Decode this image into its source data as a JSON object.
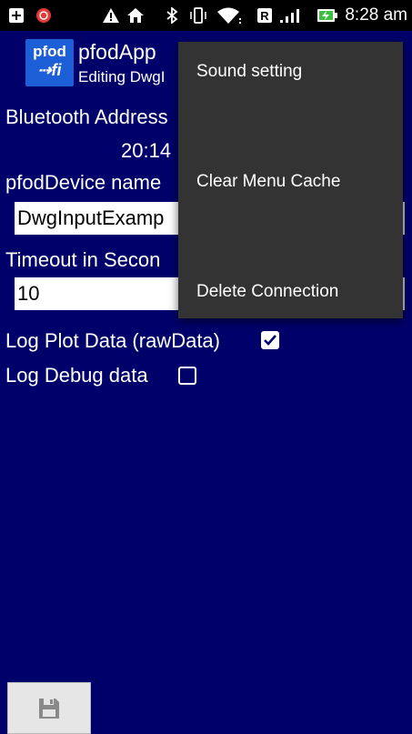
{
  "status_bar": {
    "time": "8:28 am",
    "icons": [
      "add-box-icon",
      "record-icon",
      "warning-icon",
      "home-icon",
      "bluetooth-icon",
      "vibrate-icon",
      "wifi-icon",
      "roaming-r-icon",
      "signal-icon",
      "battery-charging-icon"
    ]
  },
  "action_bar": {
    "logo_line1": "pfod",
    "logo_line2": "⇢fi",
    "title": "pfodApp",
    "subtitle": "Editing DwgI"
  },
  "form": {
    "bt_label": "Bluetooth Address",
    "bt_value": "20:14",
    "device_label": "pfodDevice name",
    "device_value": "DwgInputExamp",
    "timeout_label": "Timeout in Secon",
    "timeout_value": "10",
    "log_plot_label": "Log Plot Data (rawData)",
    "log_plot_checked": true,
    "log_debug_label": "Log Debug data",
    "log_debug_checked": false
  },
  "menu": {
    "items": [
      "Sound setting",
      "Clear Menu Cache",
      "Delete Connection"
    ]
  },
  "bottom": {
    "save_icon": "save-floppy-icon"
  },
  "colors": {
    "background": "#00006b",
    "menu_bg": "#333333",
    "logo_bg": "#1d5fd6"
  }
}
